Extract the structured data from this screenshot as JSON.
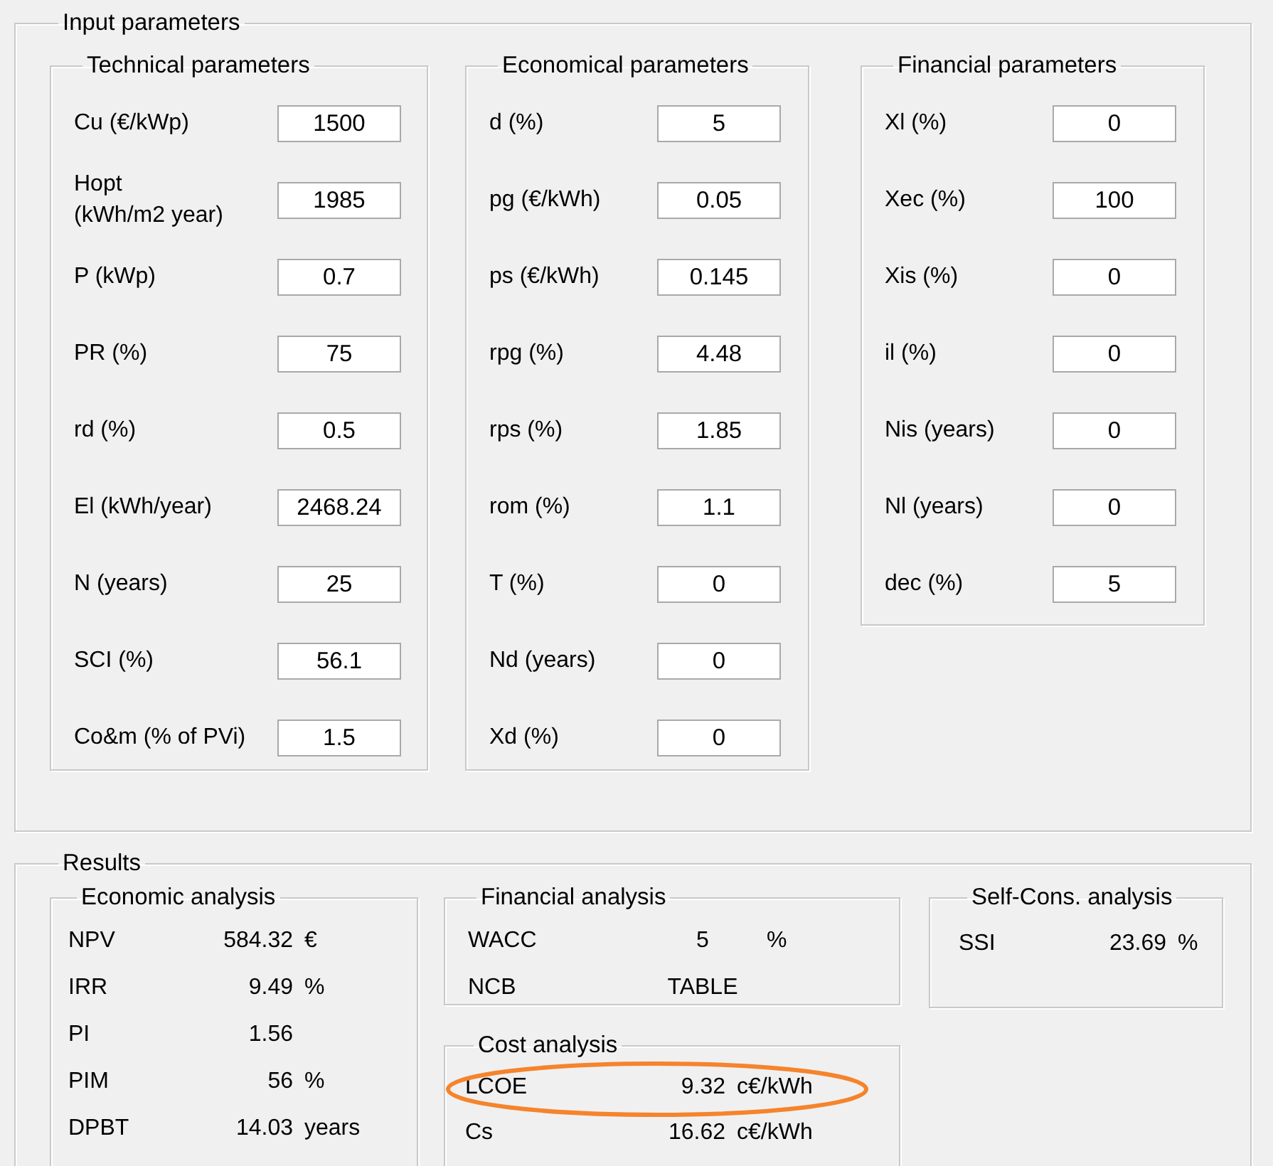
{
  "input_parameters": {
    "title": "Input parameters",
    "groups": [
      {
        "title": "Technical parameters",
        "fields": [
          {
            "label": "Cu (€/kWp)",
            "value": "1500"
          },
          {
            "label": "Hopt\n(kWh/m2 year)",
            "value": "1985"
          },
          {
            "label": "P (kWp)",
            "value": "0.7"
          },
          {
            "label": "PR (%)",
            "value": "75"
          },
          {
            "label": "rd (%)",
            "value": "0.5"
          },
          {
            "label": "El (kWh/year)",
            "value": "2468.24"
          },
          {
            "label": "N (years)",
            "value": "25"
          },
          {
            "label": "SCI (%)",
            "value": "56.1"
          },
          {
            "label": "Co&m (% of PVi)",
            "value": "1.5"
          }
        ]
      },
      {
        "title": "Economical parameters",
        "fields": [
          {
            "label": "d (%)",
            "value": "5"
          },
          {
            "label": "pg (€/kWh)",
            "value": "0.05"
          },
          {
            "label": "ps (€/kWh)",
            "value": "0.145"
          },
          {
            "label": "rpg (%)",
            "value": "4.48"
          },
          {
            "label": "rps (%)",
            "value": "1.85"
          },
          {
            "label": "rom (%)",
            "value": "1.1"
          },
          {
            "label": "T (%)",
            "value": "0"
          },
          {
            "label": "Nd (years)",
            "value": "0"
          },
          {
            "label": "Xd (%)",
            "value": "0"
          }
        ]
      },
      {
        "title": "Financial parameters",
        "fields": [
          {
            "label": "Xl (%)",
            "value": "0"
          },
          {
            "label": "Xec (%)",
            "value": "100"
          },
          {
            "label": "Xis (%)",
            "value": "0"
          },
          {
            "label": "il (%)",
            "value": "0"
          },
          {
            "label": "Nis (years)",
            "value": "0"
          },
          {
            "label": "Nl (years)",
            "value": "0"
          },
          {
            "label": "dec (%)",
            "value": "5"
          }
        ]
      }
    ]
  },
  "results": {
    "title": "Results",
    "economic_analysis": {
      "title": "Economic analysis",
      "rows": [
        {
          "label": "NPV",
          "value": "584.32",
          "unit": "€"
        },
        {
          "label": "IRR",
          "value": "9.49",
          "unit": "%"
        },
        {
          "label": "PI",
          "value": "1.56"
        },
        {
          "label": "PIM",
          "value": "56",
          "unit": "%"
        },
        {
          "label": "DPBT",
          "value": "14.03",
          "unit": "years"
        }
      ]
    },
    "financial_analysis": {
      "title": "Financial analysis",
      "rows": [
        {
          "label": "WACC",
          "value": "5",
          "unit": "%"
        },
        {
          "label": "NCB",
          "value": "TABLE"
        }
      ]
    },
    "cost_analysis": {
      "title": "Cost analysis",
      "highlighted": true,
      "rows": [
        {
          "label": "LCOE",
          "value": "9.32",
          "unit": "c€/kWh"
        },
        {
          "label": "Cs",
          "value": "16.62",
          "unit": "c€/kWh"
        }
      ]
    },
    "self_cons_analysis": {
      "title": "Self-Cons. analysis",
      "rows": [
        {
          "label": "SSI",
          "value": "23.69",
          "unit": "%"
        }
      ]
    }
  }
}
